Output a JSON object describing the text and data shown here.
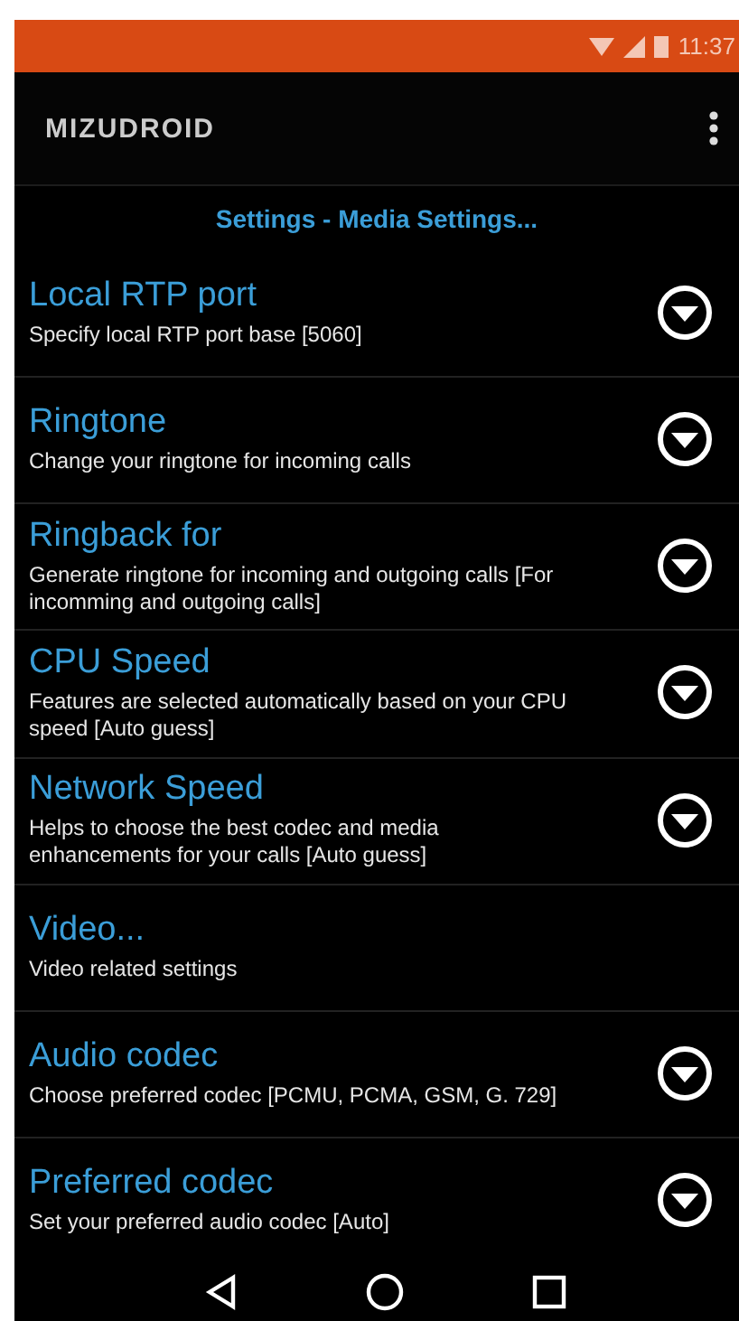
{
  "status_bar": {
    "time": "11:37"
  },
  "app_bar": {
    "logo": "MIZUDROID"
  },
  "header": {
    "title": "Settings - Media Settings..."
  },
  "items": [
    {
      "kind": "dropdown",
      "title": "Local RTP port",
      "summary": "Specify local RTP port base [5060]"
    },
    {
      "kind": "dropdown",
      "title": "Ringtone",
      "summary": "Change your ringtone for incoming calls"
    },
    {
      "kind": "dropdown",
      "title": "Ringback for",
      "summary": "Generate ringtone for incoming and outgoing calls [For incomming and outgoing calls]"
    },
    {
      "kind": "dropdown",
      "title": "CPU Speed",
      "summary": "Features are selected automatically based on your CPU speed [Auto guess]"
    },
    {
      "kind": "dropdown",
      "title": "Network Speed",
      "summary": "Helps to choose the best codec and media enhancements for your calls [Auto guess]"
    },
    {
      "kind": "screen",
      "title": "Video...",
      "summary": "Video related settings"
    },
    {
      "kind": "dropdown",
      "title": "Audio codec",
      "summary": "Choose preferred codec [PCMU, PCMA, GSM, G. 729]"
    },
    {
      "kind": "dropdown",
      "title": "Preferred codec",
      "summary": "Set your preferred audio codec [Auto]"
    }
  ]
}
